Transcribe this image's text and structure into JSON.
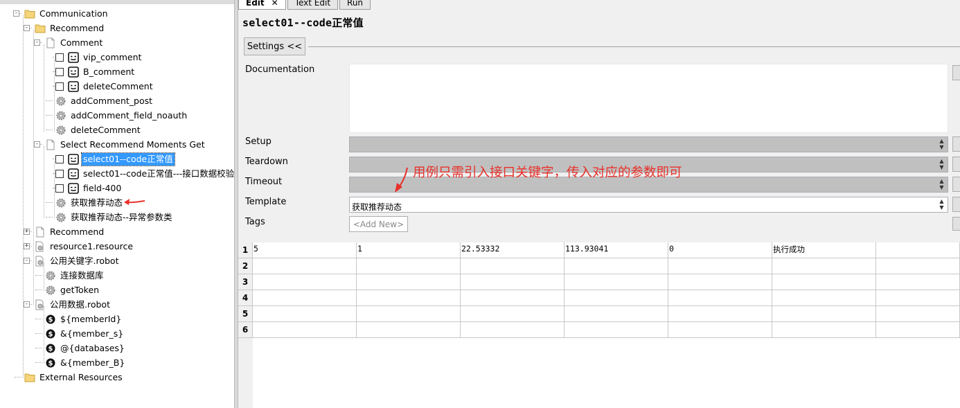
{
  "tree": {
    "items": [
      {
        "label": "Communication",
        "icon": "folder-icon"
      },
      {
        "label": "Recommend",
        "icon": "folder-icon"
      },
      {
        "label": "Comment",
        "icon": "file-icon"
      },
      {
        "label": "vip_comment",
        "icon": "keyword-icon"
      },
      {
        "label": "B_comment",
        "icon": "keyword-icon"
      },
      {
        "label": "deleteComment",
        "icon": "keyword-icon"
      },
      {
        "label": "addComment_post",
        "icon": "gear-icon"
      },
      {
        "label": "addComment_field_noauth",
        "icon": "gear-icon"
      },
      {
        "label": "deleteComment",
        "icon": "gear-icon"
      },
      {
        "label": "Select Recommend Moments Get",
        "icon": "file-icon"
      },
      {
        "label": "select01--code正常值",
        "icon": "keyword-icon"
      },
      {
        "label": "select01--code正常值---接口数据校验",
        "icon": "keyword-icon"
      },
      {
        "label": "field-400",
        "icon": "keyword-icon"
      },
      {
        "label": "获取推荐动态",
        "icon": "gear-icon"
      },
      {
        "label": "获取推荐动态--异常参数类",
        "icon": "gear-icon"
      },
      {
        "label": "Recommend",
        "icon": "file-icon"
      },
      {
        "label": "resource1.resource",
        "icon": "resource-icon"
      },
      {
        "label": "公用关键字.robot",
        "icon": "resource-icon"
      },
      {
        "label": "连接数据库",
        "icon": "gear-icon"
      },
      {
        "label": "getToken",
        "icon": "gear-icon"
      },
      {
        "label": "公用数据.robot",
        "icon": "resource-icon"
      },
      {
        "label": "${memberId}",
        "icon": "variable-icon"
      },
      {
        "label": "&{member_s}",
        "icon": "variable-icon"
      },
      {
        "label": "@{databases}",
        "icon": "variable-icon"
      },
      {
        "label": "&{member_B}",
        "icon": "variable-icon"
      },
      {
        "label": "External Resources",
        "icon": "folder-icon"
      }
    ]
  },
  "tabs": [
    {
      "label": "Edit",
      "close": "✕"
    },
    {
      "label": "Text Edit"
    },
    {
      "label": "Run"
    }
  ],
  "editor": {
    "title": "select01--code正常值",
    "settings_label": "Settings <<",
    "labels": {
      "documentation": "Documentation",
      "setup": "Setup",
      "teardown": "Teardown",
      "timeout": "Timeout",
      "template": "Template",
      "tags": "Tags"
    },
    "template_value": "获取推荐动态",
    "tags_button": "<Add New>"
  },
  "annotation": "用例只需引入接口关键字，传入对应的参数即可",
  "grid": {
    "row_headers": [
      "1",
      "2",
      "3",
      "4",
      "5",
      "6"
    ],
    "rows": [
      [
        "5",
        "1",
        "22.53332",
        "113.93041",
        "0",
        "执行成功",
        ""
      ],
      [
        "",
        "",
        "",
        "",
        "",
        "",
        ""
      ],
      [
        "",
        "",
        "",
        "",
        "",
        "",
        ""
      ],
      [
        "",
        "",
        "",
        "",
        "",
        "",
        ""
      ],
      [
        "",
        "",
        "",
        "",
        "",
        "",
        ""
      ],
      [
        "",
        "",
        "",
        "",
        "",
        "",
        ""
      ]
    ]
  },
  "colors": {
    "selection": "#3399ff",
    "annotation": "#e8312a",
    "disabled_field": "#c0c0c0"
  }
}
